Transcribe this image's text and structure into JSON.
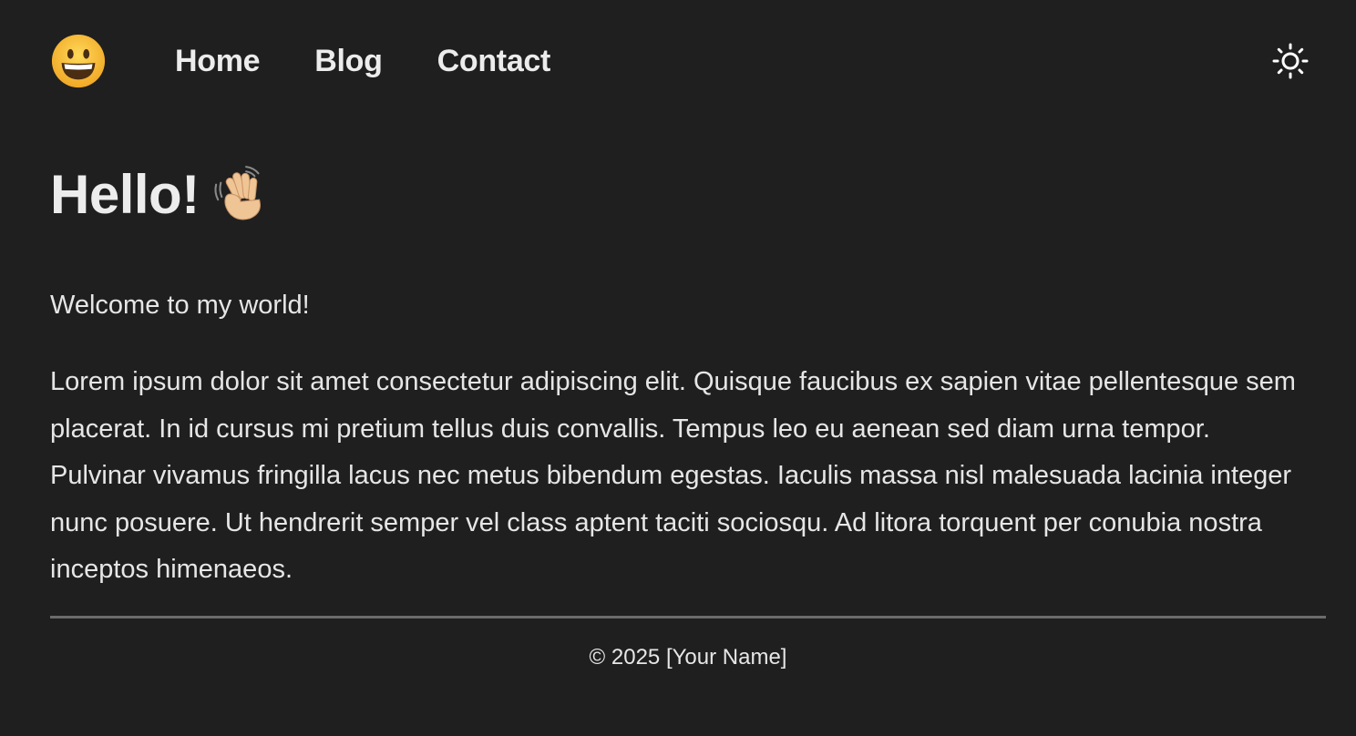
{
  "header": {
    "logo_icon": "grinning-face-emoji",
    "nav": [
      {
        "label": "Home"
      },
      {
        "label": "Blog"
      },
      {
        "label": "Contact"
      }
    ],
    "theme_toggle_icon": "sun-icon"
  },
  "main": {
    "title": "Hello!",
    "title_icon": "waving-hand-emoji",
    "welcome": "Welcome to my world!",
    "body": "Lorem ipsum dolor sit amet consectetur adipiscing elit. Quisque faucibus ex sapien vitae pellentesque sem placerat. In id cursus mi pretium tellus duis convallis. Tempus leo eu aenean sed diam urna tempor. Pulvinar vivamus fringilla lacus nec metus bibendum egestas. Iaculis massa nisl malesuada lacinia integer nunc posuere. Ut hendrerit semper vel class aptent taciti sociosqu. Ad litora torquent per conubia nostra inceptos himenaeos."
  },
  "footer": {
    "copyright": "© 2025 [Your Name]"
  },
  "colors": {
    "background": "#1f1f1f",
    "text": "#e6e6e6",
    "divider": "#6b6b6b",
    "emoji_yellow": "#f7c23a"
  }
}
